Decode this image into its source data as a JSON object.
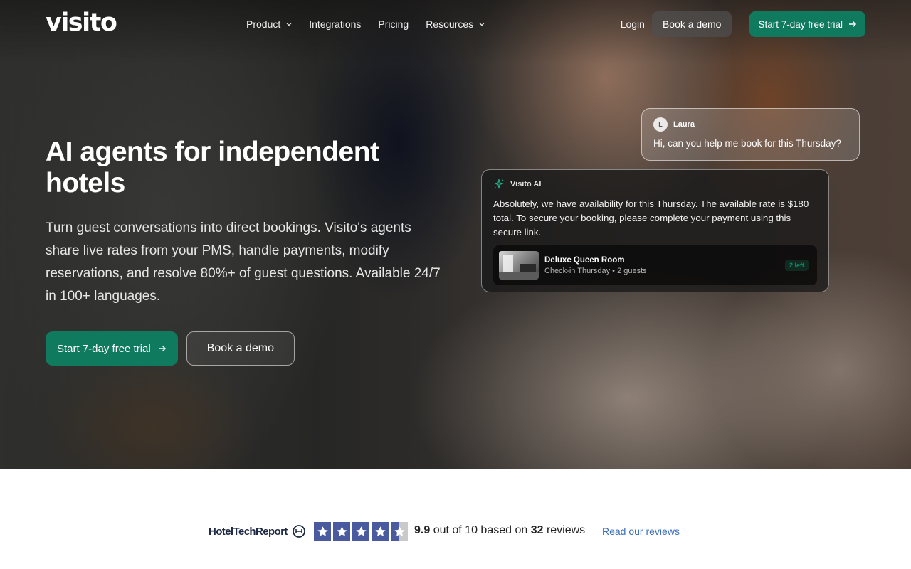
{
  "nav": {
    "logo": "visito",
    "links": [
      {
        "label": "Product",
        "dropdown": true
      },
      {
        "label": "Integrations",
        "dropdown": false
      },
      {
        "label": "Pricing",
        "dropdown": false
      },
      {
        "label": "Resources",
        "dropdown": true
      }
    ],
    "login": "Login",
    "book_demo": "Book a demo",
    "trial": "Start 7-day free trial"
  },
  "hero": {
    "headline": "AI agents for independent hotels",
    "subtext": "Turn guest conversations into direct bookings. Visito's agents share live rates from your PMS, handle payments, modify reservations, and resolve 80%+ of guest questions. Available 24/7 in 100+ languages.",
    "cta_primary": "Start 7-day free trial",
    "cta_secondary": "Book a demo"
  },
  "chat": {
    "user": {
      "initial": "L",
      "name": "Laura",
      "message": "Hi, can you help me book for this Thursday?"
    },
    "ai": {
      "name": "Visito AI",
      "message": "Absolutely, we have availability for this Thursday. The available rate is $180 total. To secure your booking, please complete your payment using this secure link.",
      "room": {
        "title": "Deluxe Queen Room",
        "subtitle": "Check-in Thursday • 2 guests",
        "badge": "2 left"
      }
    }
  },
  "reviews": {
    "brand": "HotelTechReport",
    "stars_filled": 4.5,
    "stars_total": 5,
    "score": "9.9",
    "out_of_text": " out of 10 based on ",
    "count": "32",
    "reviews_word": " reviews",
    "link": "Read our reviews"
  },
  "colors": {
    "accent": "#0f7a5e",
    "star": "#4a5a9f",
    "link": "#3a6fb8"
  },
  "icons": [
    "chevron-down-icon",
    "arrow-right-icon",
    "sparkle-icon",
    "star-icon",
    "hoteltechreport-logo-icon"
  ]
}
